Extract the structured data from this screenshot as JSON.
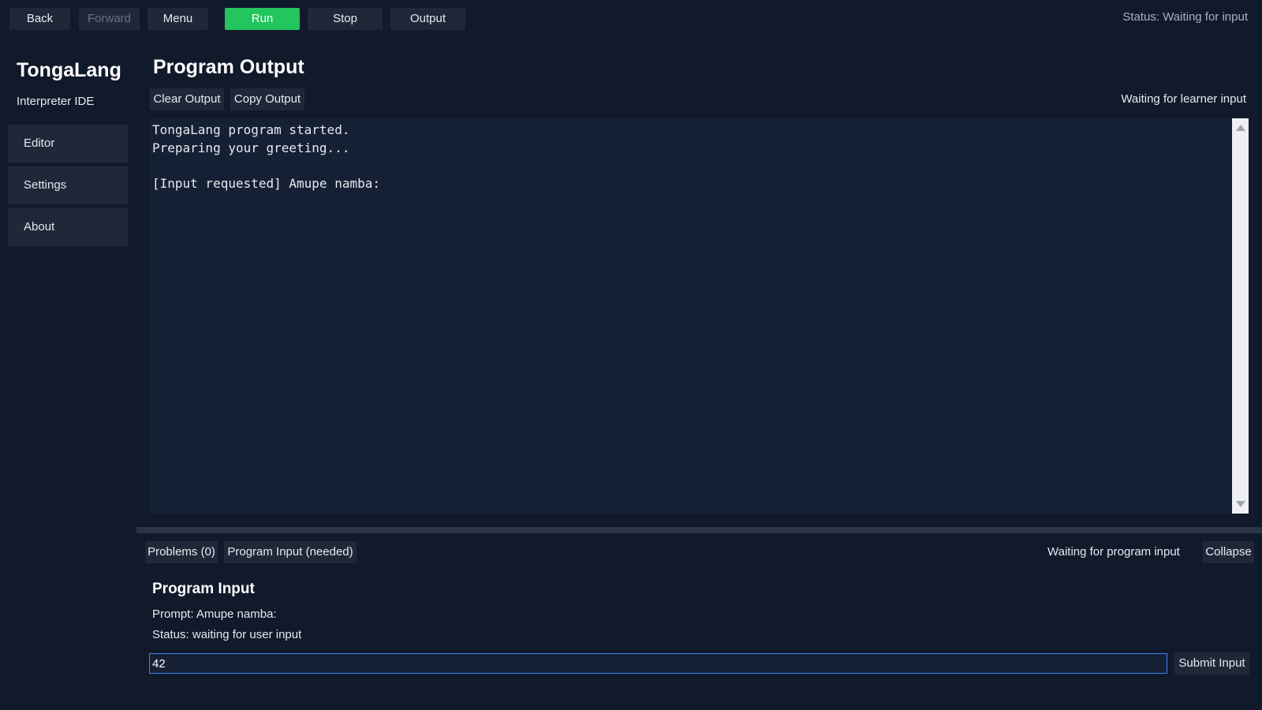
{
  "toolbar": {
    "back": "Back",
    "forward": "Forward",
    "menu": "Menu",
    "run": "Run",
    "stop": "Stop",
    "output": "Output",
    "status": "Status: Waiting for input"
  },
  "sidebar": {
    "brand": "TongaLang",
    "subtitle": "Interpreter IDE",
    "items": [
      {
        "label": "Editor"
      },
      {
        "label": "Settings"
      },
      {
        "label": "About"
      }
    ]
  },
  "main": {
    "title": "Program Output",
    "clear_output": "Clear Output",
    "copy_output": "Copy Output",
    "status": "Waiting for learner input",
    "console_text": "TongaLang program started.\nPreparing your greeting...\n\n[Input requested] Amupe namba:"
  },
  "bottom_panel": {
    "tabs": [
      {
        "label": "Problems (0)"
      },
      {
        "label": "Program Input (needed)"
      }
    ],
    "status": "Waiting for program input",
    "collapse": "Collapse",
    "title": "Program Input",
    "prompt": "Prompt: Amupe namba:",
    "input_status": "Status: waiting for user input",
    "input_value": "42",
    "submit": "Submit Input"
  },
  "colors": {
    "background": "#111a2b",
    "button": "#1f2838",
    "run_accent": "#22c55e",
    "input_focus": "#3b82f6"
  }
}
